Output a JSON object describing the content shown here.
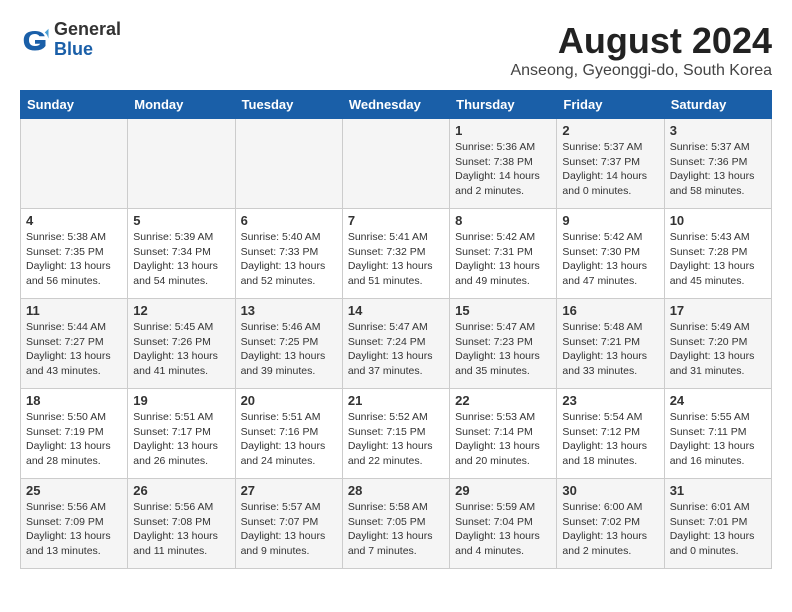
{
  "header": {
    "logo_general": "General",
    "logo_blue": "Blue",
    "month_year": "August 2024",
    "location": "Anseong, Gyeonggi-do, South Korea"
  },
  "days_of_week": [
    "Sunday",
    "Monday",
    "Tuesday",
    "Wednesday",
    "Thursday",
    "Friday",
    "Saturday"
  ],
  "weeks": [
    [
      {
        "day": "",
        "info": ""
      },
      {
        "day": "",
        "info": ""
      },
      {
        "day": "",
        "info": ""
      },
      {
        "day": "",
        "info": ""
      },
      {
        "day": "1",
        "info": "Sunrise: 5:36 AM\nSunset: 7:38 PM\nDaylight: 14 hours\nand 2 minutes."
      },
      {
        "day": "2",
        "info": "Sunrise: 5:37 AM\nSunset: 7:37 PM\nDaylight: 14 hours\nand 0 minutes."
      },
      {
        "day": "3",
        "info": "Sunrise: 5:37 AM\nSunset: 7:36 PM\nDaylight: 13 hours\nand 58 minutes."
      }
    ],
    [
      {
        "day": "4",
        "info": "Sunrise: 5:38 AM\nSunset: 7:35 PM\nDaylight: 13 hours\nand 56 minutes."
      },
      {
        "day": "5",
        "info": "Sunrise: 5:39 AM\nSunset: 7:34 PM\nDaylight: 13 hours\nand 54 minutes."
      },
      {
        "day": "6",
        "info": "Sunrise: 5:40 AM\nSunset: 7:33 PM\nDaylight: 13 hours\nand 52 minutes."
      },
      {
        "day": "7",
        "info": "Sunrise: 5:41 AM\nSunset: 7:32 PM\nDaylight: 13 hours\nand 51 minutes."
      },
      {
        "day": "8",
        "info": "Sunrise: 5:42 AM\nSunset: 7:31 PM\nDaylight: 13 hours\nand 49 minutes."
      },
      {
        "day": "9",
        "info": "Sunrise: 5:42 AM\nSunset: 7:30 PM\nDaylight: 13 hours\nand 47 minutes."
      },
      {
        "day": "10",
        "info": "Sunrise: 5:43 AM\nSunset: 7:28 PM\nDaylight: 13 hours\nand 45 minutes."
      }
    ],
    [
      {
        "day": "11",
        "info": "Sunrise: 5:44 AM\nSunset: 7:27 PM\nDaylight: 13 hours\nand 43 minutes."
      },
      {
        "day": "12",
        "info": "Sunrise: 5:45 AM\nSunset: 7:26 PM\nDaylight: 13 hours\nand 41 minutes."
      },
      {
        "day": "13",
        "info": "Sunrise: 5:46 AM\nSunset: 7:25 PM\nDaylight: 13 hours\nand 39 minutes."
      },
      {
        "day": "14",
        "info": "Sunrise: 5:47 AM\nSunset: 7:24 PM\nDaylight: 13 hours\nand 37 minutes."
      },
      {
        "day": "15",
        "info": "Sunrise: 5:47 AM\nSunset: 7:23 PM\nDaylight: 13 hours\nand 35 minutes."
      },
      {
        "day": "16",
        "info": "Sunrise: 5:48 AM\nSunset: 7:21 PM\nDaylight: 13 hours\nand 33 minutes."
      },
      {
        "day": "17",
        "info": "Sunrise: 5:49 AM\nSunset: 7:20 PM\nDaylight: 13 hours\nand 31 minutes."
      }
    ],
    [
      {
        "day": "18",
        "info": "Sunrise: 5:50 AM\nSunset: 7:19 PM\nDaylight: 13 hours\nand 28 minutes."
      },
      {
        "day": "19",
        "info": "Sunrise: 5:51 AM\nSunset: 7:17 PM\nDaylight: 13 hours\nand 26 minutes."
      },
      {
        "day": "20",
        "info": "Sunrise: 5:51 AM\nSunset: 7:16 PM\nDaylight: 13 hours\nand 24 minutes."
      },
      {
        "day": "21",
        "info": "Sunrise: 5:52 AM\nSunset: 7:15 PM\nDaylight: 13 hours\nand 22 minutes."
      },
      {
        "day": "22",
        "info": "Sunrise: 5:53 AM\nSunset: 7:14 PM\nDaylight: 13 hours\nand 20 minutes."
      },
      {
        "day": "23",
        "info": "Sunrise: 5:54 AM\nSunset: 7:12 PM\nDaylight: 13 hours\nand 18 minutes."
      },
      {
        "day": "24",
        "info": "Sunrise: 5:55 AM\nSunset: 7:11 PM\nDaylight: 13 hours\nand 16 minutes."
      }
    ],
    [
      {
        "day": "25",
        "info": "Sunrise: 5:56 AM\nSunset: 7:09 PM\nDaylight: 13 hours\nand 13 minutes."
      },
      {
        "day": "26",
        "info": "Sunrise: 5:56 AM\nSunset: 7:08 PM\nDaylight: 13 hours\nand 11 minutes."
      },
      {
        "day": "27",
        "info": "Sunrise: 5:57 AM\nSunset: 7:07 PM\nDaylight: 13 hours\nand 9 minutes."
      },
      {
        "day": "28",
        "info": "Sunrise: 5:58 AM\nSunset: 7:05 PM\nDaylight: 13 hours\nand 7 minutes."
      },
      {
        "day": "29",
        "info": "Sunrise: 5:59 AM\nSunset: 7:04 PM\nDaylight: 13 hours\nand 4 minutes."
      },
      {
        "day": "30",
        "info": "Sunrise: 6:00 AM\nSunset: 7:02 PM\nDaylight: 13 hours\nand 2 minutes."
      },
      {
        "day": "31",
        "info": "Sunrise: 6:01 AM\nSunset: 7:01 PM\nDaylight: 13 hours\nand 0 minutes."
      }
    ]
  ]
}
